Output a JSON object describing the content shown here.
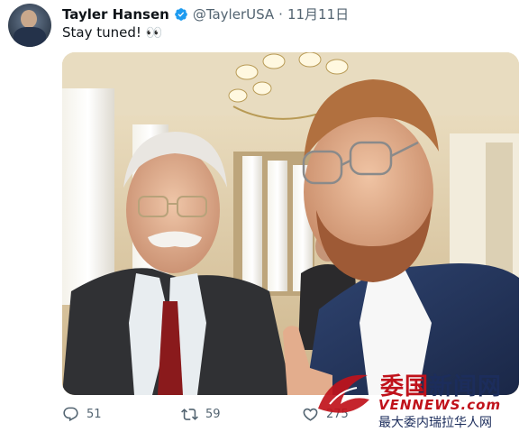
{
  "tweet": {
    "author_name": "Tayler Hansen",
    "handle": "@TaylerUSA",
    "separator": "·",
    "date": "11月11日",
    "text": "Stay tuned!",
    "emoji": "👀"
  },
  "actions": {
    "reply_count": "51",
    "retweet_count": "59",
    "like_count": "275"
  },
  "watermark": {
    "title_part1": "委国",
    "title_part2": "新闻网",
    "url": "VENNEWS.com",
    "subtitle": "最大委内瑞拉华人网"
  },
  "colors": {
    "verified_blue": "#1d9bf0",
    "text_primary": "#0f1419",
    "text_secondary": "#536471",
    "watermark_red": "#c0121b",
    "watermark_navy": "#1c2d5c"
  },
  "icons": {
    "verified": "verified-badge-icon",
    "reply": "reply-icon",
    "retweet": "retweet-icon",
    "like": "heart-icon"
  }
}
